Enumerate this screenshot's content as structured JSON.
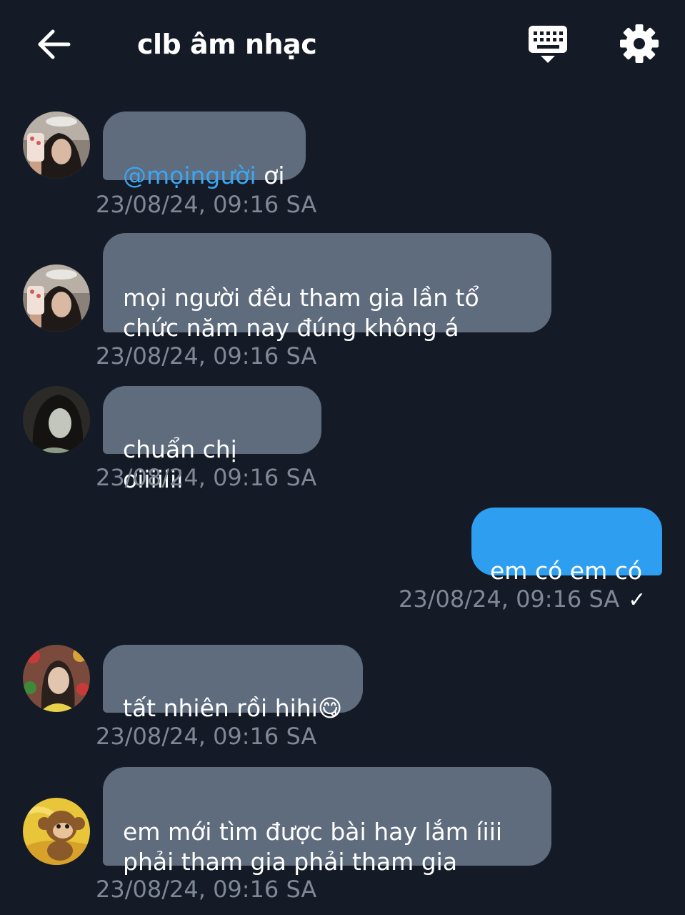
{
  "header": {
    "title": "clb âm nhạc",
    "back_icon": "arrow-left-icon",
    "keyboard_icon": "keyboard-icon",
    "settings_icon": "gear-icon"
  },
  "messages": [
    {
      "mention": "@mọingười",
      "text": " ơi",
      "time": "23/08/24, 09:16 SA",
      "avatar": "avatar-1"
    },
    {
      "text": "mọi người đều tham gia lần tổ\nchức năm nay đúng không á",
      "time": "23/08/24, 09:16 SA",
      "avatar": "avatar-1"
    },
    {
      "text": "chuẩn chị ơiiiiiii",
      "time": "23/08/24, 09:16 SA",
      "avatar": "avatar-2"
    },
    {
      "text": "em có em có",
      "time": "23/08/24, 09:16 SA",
      "outgoing": true,
      "status": "✓"
    },
    {
      "text": "tất nhiên rồi hihi",
      "emoji": "😋",
      "time": "23/08/24, 09:16 SA",
      "avatar": "avatar-3"
    },
    {
      "text": "em mới tìm được bài hay lắm íiii\nphải tham gia phải tham gia",
      "time": "23/08/24, 09:16 SA",
      "avatar": "avatar-4"
    }
  ],
  "colors": {
    "background": "#151b26",
    "incoming_bubble": "#5e6c7e",
    "outgoing_bubble": "#2e9ef0",
    "mention": "#3aa7f5",
    "timestamp": "#7f8897"
  }
}
